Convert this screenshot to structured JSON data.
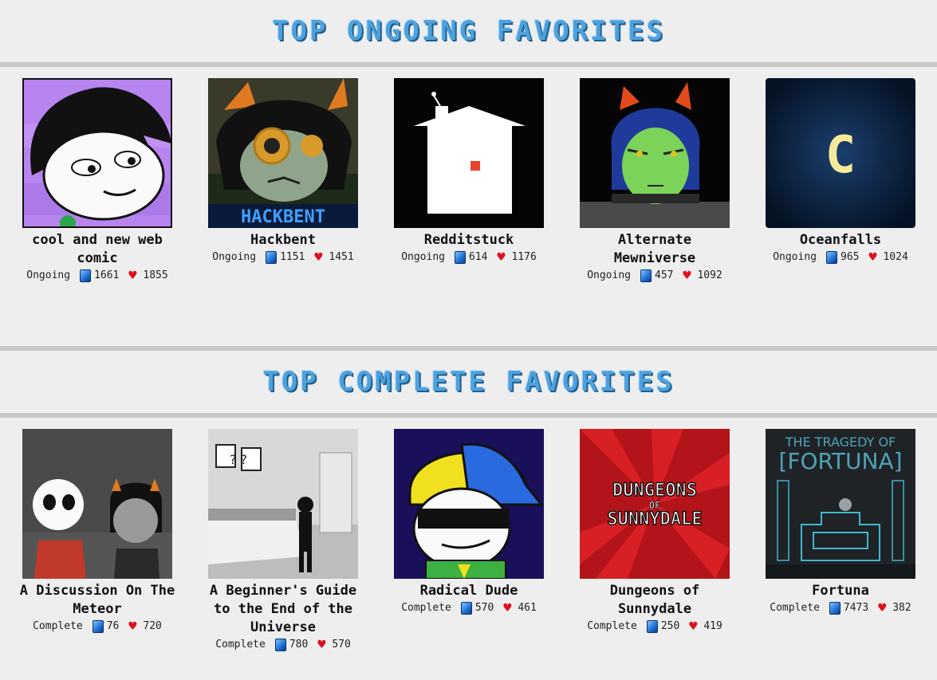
{
  "ongoing": {
    "heading": "Top Ongoing Favorites",
    "items": [
      {
        "title": "cool and new web comic",
        "status": "Ongoing",
        "pages": "1661",
        "favs": "1855"
      },
      {
        "title": "Hackbent",
        "status": "Ongoing",
        "pages": "1151",
        "favs": "1451",
        "art_text": "HACKBENT"
      },
      {
        "title": "Redditstuck",
        "status": "Ongoing",
        "pages": "614",
        "favs": "1176"
      },
      {
        "title": "Alternate Mewniverse",
        "status": "Ongoing",
        "pages": "457",
        "favs": "1092"
      },
      {
        "title": "Oceanfalls",
        "status": "Ongoing",
        "pages": "965",
        "favs": "1024",
        "art_text": "C"
      }
    ]
  },
  "complete": {
    "heading": "Top Complete Favorites",
    "items": [
      {
        "title": "A Discussion On The Meteor",
        "status": "Complete",
        "pages": "76",
        "favs": "720"
      },
      {
        "title": "A Beginner's Guide to the End of the Universe",
        "status": "Complete",
        "pages": "780",
        "favs": "570",
        "art_text": "? ?"
      },
      {
        "title": "Radical Dude",
        "status": "Complete",
        "pages": "570",
        "favs": "461"
      },
      {
        "title": "Dungeons of Sunnydale",
        "status": "Complete",
        "pages": "250",
        "favs": "419",
        "art_text_line1": "DUNGEONS",
        "art_text_line2": "OF",
        "art_text_line3": "SUNNYDALE"
      },
      {
        "title": "Fortuna",
        "status": "Complete",
        "pages": "7473",
        "favs": "382",
        "art_text_line1": "THE TRAGEDY OF",
        "art_text_line2": "[FORTUNA]"
      }
    ]
  },
  "icons": {
    "pages": "pages-icon",
    "favs": "heart-icon"
  },
  "colors": {
    "heading": "#4ea1dd",
    "divider": "#c8c8c8",
    "background": "#eeeeee",
    "heart": "#e01020",
    "pages": "#1f6fd1"
  }
}
